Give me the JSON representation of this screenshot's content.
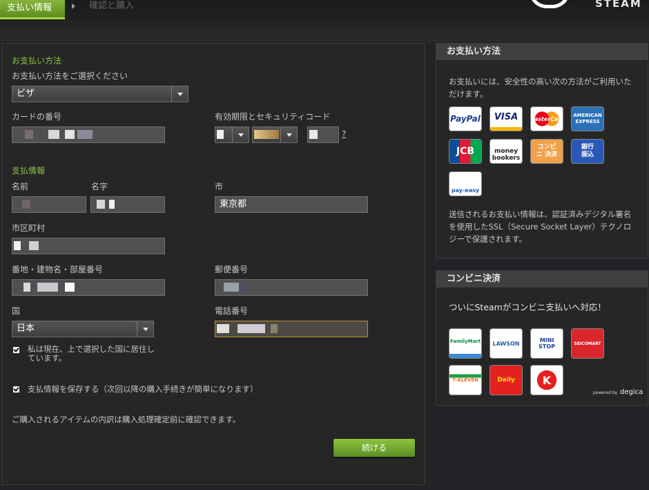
{
  "header": {
    "tab_active": "支払い情報",
    "tab_next": "確認と購入",
    "logo_text": "STEAM"
  },
  "payment": {
    "section_title": "お支払い方法",
    "method_label": "お支払い方法をご選択ください",
    "method_value": "ビザ",
    "card_number_label": "カードの番号",
    "expiry_label": "有効期限とセキュリティコード",
    "help_link": "?"
  },
  "billing": {
    "section_title": "支払情報",
    "first_name_label": "名前",
    "last_name_label": "名字",
    "city_label": "市",
    "city_value": "東京都",
    "ward_label": "市区町村",
    "address_label": "番地・建物名・部屋番号",
    "postal_label": "郵便番号",
    "country_label": "国",
    "country_value": "日本",
    "phone_label": "電話番号",
    "residence_check_label": "私は現在、上で選択した国に居住し\nています。",
    "save_check_label": "支払情報を保存する（次回以降の購入手続きが簡単になります）",
    "notice": "ご購入されるアイテムの内訳は購入処理確定前に確認できます。",
    "continue_button": "続ける"
  },
  "sidebar_methods": {
    "title": "お支払い方法",
    "intro": "お支払いには、安全性の高い次の方法がご利用いただけます。",
    "logos": [
      "PayPal",
      "VISA",
      "MasterCard",
      "AMERICAN EXPRESS",
      "JCB",
      "money bookers",
      "コンビニ 決済",
      "銀行 振込",
      "pay-easy"
    ],
    "security_text": "送信されるお支払い情報は、認証済みデジタル署名を使用したSSL（Secure Socket Layer）テクノロジーで保護されます。"
  },
  "sidebar_konbini": {
    "title": "コンビニ決済",
    "headline": "ついにSteamがコンビニ支払いへ対応！",
    "stores": [
      "FamilyMart",
      "LAWSON",
      "MINI STOP",
      "SEICOMART",
      "7-ELEVEN",
      "Daily",
      "K"
    ],
    "powered_by": "powered by",
    "powered_brand": "degica"
  },
  "colors": {
    "accent_green": "#8bc53f",
    "focus_border": "#bd8f30",
    "panel_bg": "#262626"
  }
}
